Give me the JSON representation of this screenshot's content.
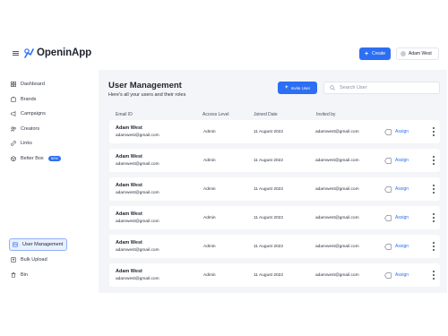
{
  "header": {
    "logo_text": "OpeninApp",
    "create_label": "Create",
    "user_name": "Adam West"
  },
  "sidebar": {
    "items": [
      {
        "label": "Dashboard",
        "icon": "grid-icon"
      },
      {
        "label": "Brands",
        "icon": "brands-icon"
      },
      {
        "label": "Campaigns",
        "icon": "megaphone-icon"
      },
      {
        "label": "Creators",
        "icon": "creators-icon"
      },
      {
        "label": "Links",
        "icon": "link-icon"
      },
      {
        "label": "Better Box",
        "icon": "box-icon",
        "badge": "NEW"
      }
    ],
    "bottom_items": [
      {
        "label": "User Management",
        "icon": "user-management-icon",
        "active": true
      },
      {
        "label": "Bulk Upload",
        "icon": "upload-icon"
      },
      {
        "label": "Bin",
        "icon": "bin-icon"
      }
    ]
  },
  "main": {
    "title": "User Management",
    "subtitle": "Here's all your users and their roles",
    "invite_label": "Invite User",
    "search_placeholder": "Search User",
    "columns": [
      "Email ID",
      "Access Level",
      "Joined Date",
      "Invited by"
    ],
    "assign_label": "Assign",
    "rows": [
      {
        "name": "Adam West",
        "email": "adamwest@gmail.com",
        "access": "Admin",
        "joined": "11 August 2022",
        "invited_by": "adamwest@gmail.com"
      },
      {
        "name": "Adam West",
        "email": "adamwest@gmail.com",
        "access": "Admin",
        "joined": "11 August 2022",
        "invited_by": "adamwest@gmail.com"
      },
      {
        "name": "Adam West",
        "email": "adamwest@gmail.com",
        "access": "Admin",
        "joined": "11 August 2022",
        "invited_by": "adamwest@gmail.com"
      },
      {
        "name": "Adam West",
        "email": "adamwest@gmail.com",
        "access": "Admin",
        "joined": "11 August 2022",
        "invited_by": "adamwest@gmail.com"
      },
      {
        "name": "Adam West",
        "email": "adamwest@gmail.com",
        "access": "Admin",
        "joined": "11 August 2022",
        "invited_by": "adamwest@gmail.com"
      },
      {
        "name": "Adam West",
        "email": "adamwest@gmail.com",
        "access": "Admin",
        "joined": "11 August 2022",
        "invited_by": "adamwest@gmail.com"
      }
    ]
  },
  "colors": {
    "accent": "#2d6ff2",
    "panel_bg": "#f4f5f8",
    "active_bg": "#e8f0ff"
  }
}
